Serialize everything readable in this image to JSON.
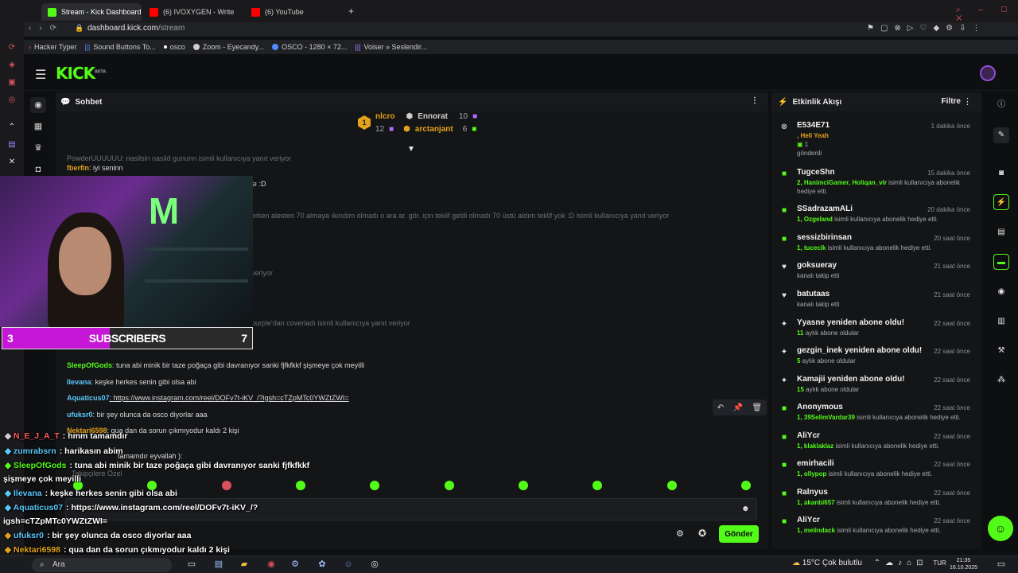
{
  "browser": {
    "tabs": [
      {
        "label": "Stream - Kick Dashboard",
        "active": true,
        "fav_color": "#53fc18"
      },
      {
        "label": "(6) IVOXYGEN - Write",
        "active": false,
        "fav_color": "#ff0000"
      },
      {
        "label": "(6) YouTube",
        "active": false,
        "fav_color": "#ff0000"
      }
    ],
    "new_tab": "+",
    "url_domain": "dashboard.kick.com",
    "url_path": "/stream",
    "bookmarks": [
      "Hacker Typer",
      "Sound Buttons To...",
      "osco",
      "Zoom - Eyecandy...",
      "OSCO - 1280 × 72...",
      "Voiser » Seslendir..."
    ]
  },
  "kick": {
    "logo_text": "KICK",
    "logo_beta": "BETA",
    "chat_title": "Sohbet",
    "pinned": {
      "rank": "1",
      "first_user": "nlcro",
      "first_count": "12",
      "second_user": "Ennorat",
      "second_count": "10",
      "third_user": "arctanjant",
      "third_count": "6"
    },
    "chat_lines": [
      {
        "user": "",
        "text": "PowderUUUUUU: nasilsin nasild gununn isimli kullanıcıya yanıt veriyor",
        "dim": true
      },
      {
        "user": "fberfin",
        "text": ": iyi seninn",
        "color": "#e2a21b"
      },
      {
        "user": "",
        "text": "sı :D",
        "dim": false
      },
      {
        "user": "",
        "text": "erken alesten 70 almaya ıkındım olmadı o ara ar. gör. için teklif geldi olmadı 70 üstü aldım teklif yok :D isimli kullanıcıya yanıt veriyor",
        "dim": true
      },
      {
        "user": "",
        "text": "veriyor",
        "dim": true
      },
      {
        "user": "",
        "text": "purple'dan coverladı isimli kullanıcıya yanıt veriyor",
        "dim": true
      },
      {
        "user": "SleepOfGods",
        "text": ": tuna abi minik bir taze poğaça gibi davranıyor sanki fjfkfkkf şişmeye çok meyilli",
        "color": "#53fc18"
      },
      {
        "user": "Ilevana",
        "text": ": keşke herkes senin gibi olsa abi",
        "color": "#5ac8fa"
      },
      {
        "user": "Aquaticus07",
        "text": ": https://www.instagram.com/reel/DOFv7t-iKV_/?igsh=cTZpMTc0YWZtZWI=",
        "color": "#5ac8fa"
      },
      {
        "user": "ufuksr0",
        "text": ": bir şey olunca da osco diyorlar aaa",
        "color": "#5ac8fa"
      },
      {
        "user": "Nektari6598",
        "text": ": qua dan da sorun çıkmıyodur kaldı 2 kişi",
        "color": "#e2a21b"
      },
      {
        "user": "",
        "text": "tamamdır eyvallah ):",
        "dim": false
      },
      {
        "user": "",
        "text": "Takipçilere Özel",
        "dim": true
      }
    ],
    "input_placeholder": "",
    "send_label": "Gönder",
    "activity_title": "Etkinlik Akışı",
    "filter_label": "Filtre",
    "events": [
      {
        "icon": "kick-icon",
        "who": "E534E71",
        "time": "1 dakika önce",
        "line1": ", Hell Yeah",
        "line2": "1",
        "line3": "gönderdi"
      },
      {
        "icon": "gift-icon",
        "who": "TugceShn",
        "time": "15 dakika önce",
        "line1": "2, HanimciGamer, Holiqan_vlr",
        "line2": " isimli kullanıcıya abonelik hediye etti."
      },
      {
        "icon": "gift-icon",
        "who": "SSadrazamALi",
        "time": "20 dakika önce",
        "line1": "1, Ozgeland",
        "line2": " isimli kullanıcıya abonelik hediye etti."
      },
      {
        "icon": "gift-icon",
        "who": "sessizbirinsan",
        "time": "20 saat önce",
        "line1": "1, tucecik",
        "line2": " isimli kullanıcıya abonelik hediye etti."
      },
      {
        "icon": "heart-icon",
        "who": "goksueray",
        "time": "21 saat önce",
        "line1": "",
        "line2": "kanalı takip etti"
      },
      {
        "icon": "heart-icon",
        "who": "batutaas",
        "time": "21 saat önce",
        "line1": "",
        "line2": "kanalı takip etti"
      },
      {
        "icon": "star-icon",
        "who": "Yyasne yeniden abone oldu!",
        "time": "22 saat önce",
        "line1": "11",
        "line2": " aylık abone oldular"
      },
      {
        "icon": "star-icon",
        "who": "gezgin_inek yeniden abone oldu!",
        "time": "22 saat önce",
        "line1": "5",
        "line2": " aylık abone oldular"
      },
      {
        "icon": "star-icon",
        "who": "Kamajii yeniden abone oldu!",
        "time": "22 saat önce",
        "line1": "15",
        "line2": " aylık abone oldular"
      },
      {
        "icon": "gift-icon",
        "who": "Anonymous",
        "time": "22 saat önce",
        "line1": "1, 39SelimVardar39",
        "line2": " isimli kullanıcıya abonelik hediye etti."
      },
      {
        "icon": "gift-icon",
        "who": "AliYcr",
        "time": "22 saat önce",
        "line1": "1, klaklaklaz",
        "line2": " isimli kullanıcıya abonelik hediye etti."
      },
      {
        "icon": "gift-icon",
        "who": "emirhacili",
        "time": "22 saat önce",
        "line1": "1, ollypop",
        "line2": " isimli kullanıcıya abonelik hediye etti."
      },
      {
        "icon": "gift-icon",
        "who": "Ralnyus",
        "time": "22 saat önce",
        "line1": "1, akanbi657",
        "line2": " isimli kullanıcıya abonelik hediye etti."
      },
      {
        "icon": "gift-icon",
        "who": "AliYcr",
        "time": "22 saat önce",
        "line1": "1, melindack",
        "line2": " isimli kullanıcıya abonelik hediye etti."
      }
    ]
  },
  "overlay": {
    "sub_current": "3",
    "sub_label": "SUBSCRIBERS",
    "sub_goal": "7",
    "sub_fill_fraction": 0.43,
    "lines": [
      {
        "user": "N_E_J_A_T",
        "text": ": hmm tamamdır",
        "color": "#ff5a5a"
      },
      {
        "user": "zumrabsrn",
        "text": ": harikasın abim",
        "color": "#5ac8fa"
      },
      {
        "user": "SleepOfGods",
        "text": ": tuna abi minik bir taze poğaça gibi davranıyor sanki fjfkfkkf",
        "color": "#53fc18"
      },
      {
        "user": "",
        "text": "şişmeye çok meyilli",
        "color": "#ffffff"
      },
      {
        "user": "Ilevana",
        "text": ": keşke herkes senin gibi olsa abi",
        "color": "#5ac8fa"
      },
      {
        "user": "Aquaticus07",
        "text": ": https://www.instagram.com/reel/DOFv7t-iKV_/?",
        "color": "#5ac8fa"
      },
      {
        "user": "",
        "text": "igsh=cTZpMTc0YWZtZWI=",
        "color": "#ffffff"
      },
      {
        "user": "ufuksr0",
        "text": ": bir şey olunca da osco diyorlar aaa",
        "color": "#5ac8fa"
      },
      {
        "user": "Nektari6598",
        "text": ": qua dan da sorun çıkmıyodur kaldı 2 kişi",
        "color": "#e2a21b"
      }
    ]
  },
  "taskbar": {
    "search_label": "Ara",
    "weather": "15°C  Çok bulutlu",
    "lang": "TUR",
    "time": "21:35",
    "date": "16.10.2025"
  }
}
